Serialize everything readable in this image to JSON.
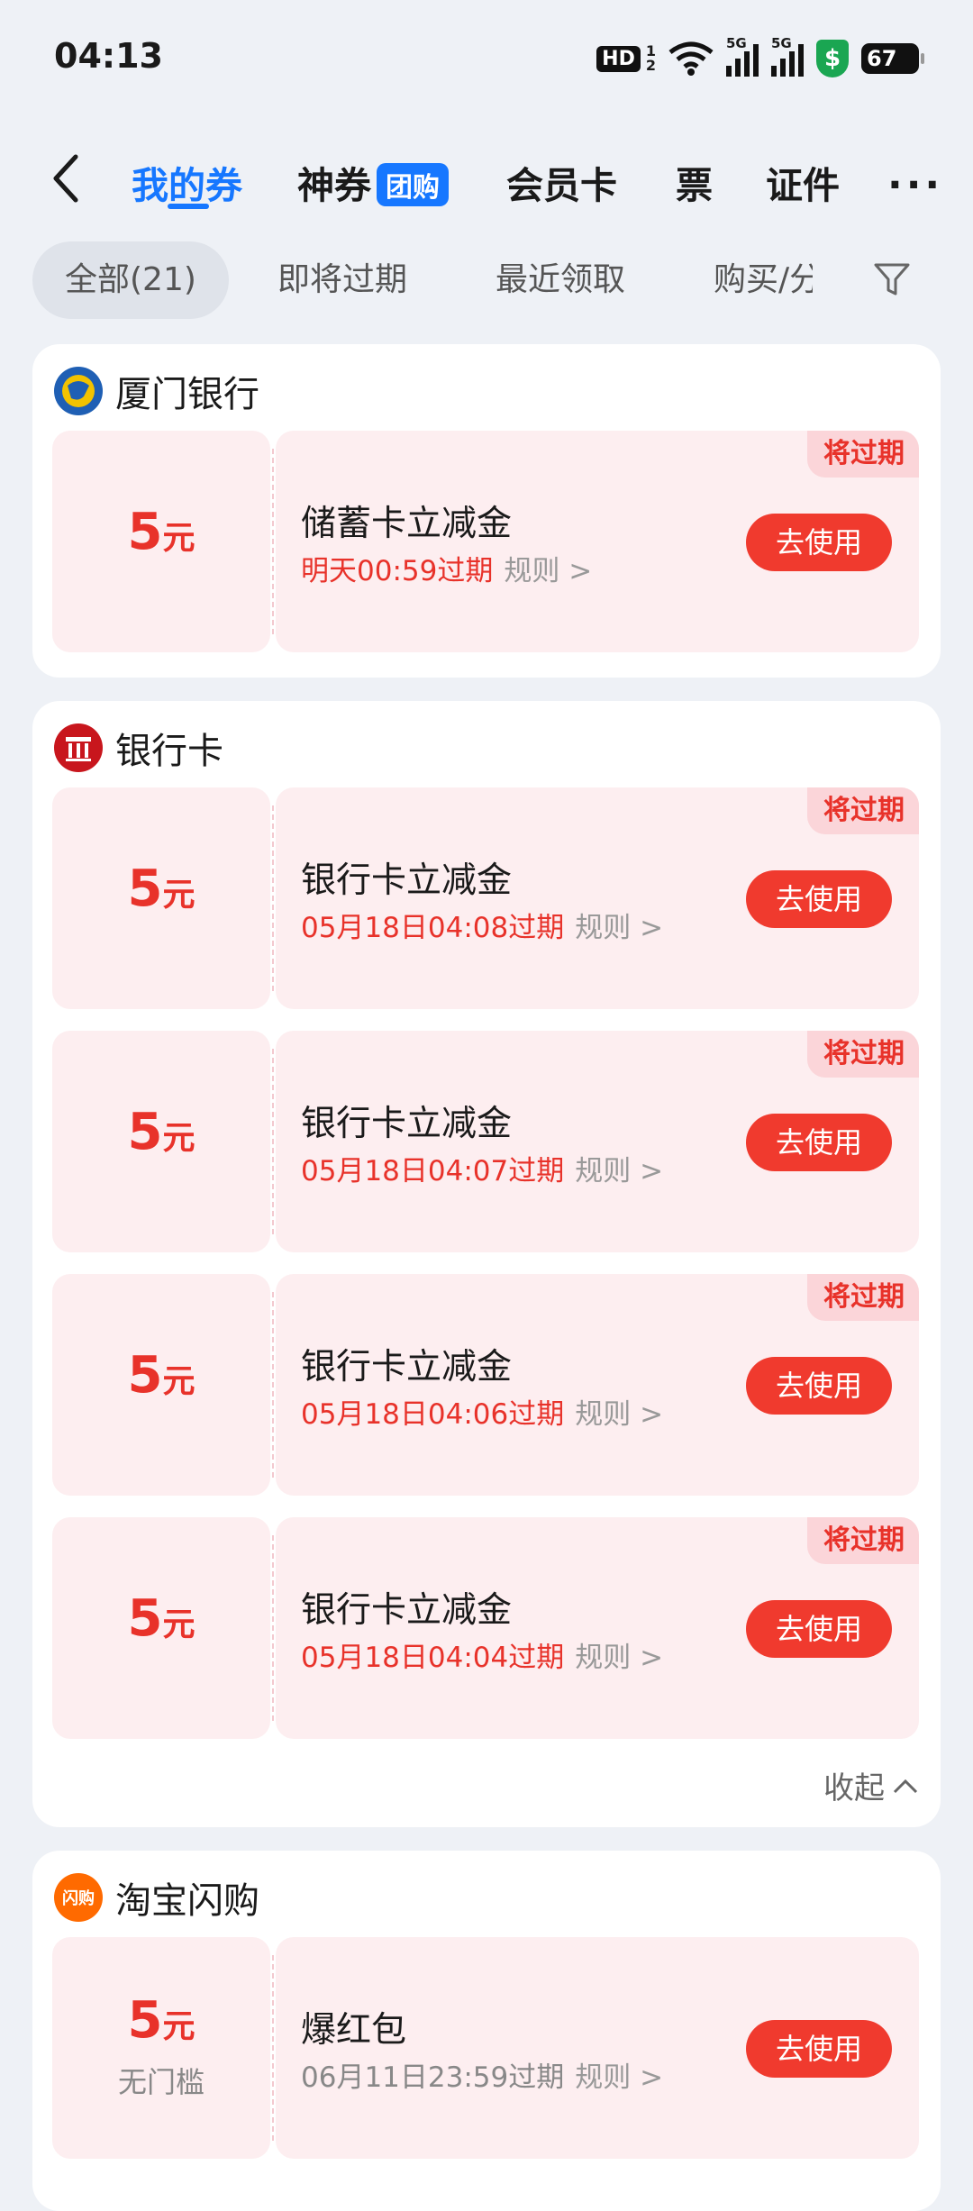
{
  "status_bar": {
    "time": "04:13",
    "hd": "HD",
    "hd_sup": "1",
    "hd_sub": "2",
    "net1": "5G",
    "net2": "5G",
    "shield_symbol": "$",
    "battery": "67"
  },
  "nav": {
    "tabs": [
      {
        "label": "我的券"
      },
      {
        "label": "神券"
      },
      {
        "label": "会员卡"
      },
      {
        "label": "票"
      },
      {
        "label": "证件"
      }
    ],
    "tuan_badge": "团购",
    "more": "···"
  },
  "filters": [
    {
      "label": "全部(21)"
    },
    {
      "label": "即将过期"
    },
    {
      "label": "最近领取"
    },
    {
      "label": "购买/分"
    }
  ],
  "sections": [
    {
      "title": "厦门银行",
      "coupons": [
        {
          "amount": "5",
          "unit": "元",
          "name": "储蓄卡立减金",
          "expire": "明天00:59过期",
          "rule": "规则 >",
          "button": "去使用",
          "tag": "将过期"
        }
      ]
    },
    {
      "title": "银行卡",
      "coupons": [
        {
          "amount": "5",
          "unit": "元",
          "name": "银行卡立减金",
          "expire": "05月18日04:08过期",
          "rule": "规则 >",
          "button": "去使用",
          "tag": "将过期"
        },
        {
          "amount": "5",
          "unit": "元",
          "name": "银行卡立减金",
          "expire": "05月18日04:07过期",
          "rule": "规则 >",
          "button": "去使用",
          "tag": "将过期"
        },
        {
          "amount": "5",
          "unit": "元",
          "name": "银行卡立减金",
          "expire": "05月18日04:06过期",
          "rule": "规则 >",
          "button": "去使用",
          "tag": "将过期"
        },
        {
          "amount": "5",
          "unit": "元",
          "name": "银行卡立减金",
          "expire": "05月18日04:04过期",
          "rule": "规则 >",
          "button": "去使用",
          "tag": "将过期"
        }
      ],
      "collapse": "收起"
    },
    {
      "title": "淘宝闪购",
      "logo_text": "闪购",
      "coupons": [
        {
          "amount": "5",
          "unit": "元",
          "sub": "无门槛",
          "name": "爆红包",
          "expire": "06月11日23:59过期",
          "rule": "规则 >",
          "button": "去使用"
        }
      ]
    }
  ]
}
